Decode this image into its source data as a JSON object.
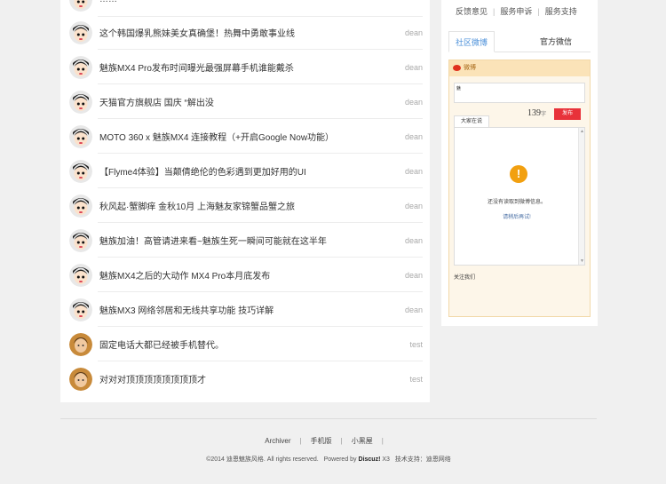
{
  "thread_list": [
    {
      "title": "……",
      "author": "",
      "avatar": "cartoon"
    },
    {
      "title": "这个韩国爆乳熊妹美女真确堡！热舞中勇敢事业线",
      "author": "dean",
      "avatar": "cartoon"
    },
    {
      "title": "魅族MX4 Pro发布时间曝光最强屏幕手机谁能戴杀",
      "author": "dean",
      "avatar": "cartoon"
    },
    {
      "title": "天猫官方旗舰店 国庆 “解出没",
      "author": "dean",
      "avatar": "cartoon"
    },
    {
      "title": "MOTO 360 x 魅族MX4 连接教程（+开启Google Now功能）",
      "author": "dean",
      "avatar": "cartoon"
    },
    {
      "title": "【Flyme4体验】当颠倩绝伦的色彩遇到更加好用的UI",
      "author": "dean",
      "avatar": "cartoon"
    },
    {
      "title": "秋风起·蟹脚痒 金秋10月 上海魅友家锦蟹品蟹之旅",
      "author": "dean",
      "avatar": "cartoon"
    },
    {
      "title": "魅族加油！高管请进来看~魅族生死一瞬间可能就在这半年",
      "author": "dean",
      "avatar": "cartoon"
    },
    {
      "title": "魅族MX4之后的大动作 MX4 Pro本月底发布",
      "author": "dean",
      "avatar": "cartoon"
    },
    {
      "title": "魅族MX3 网络邻居和无线共享功能 技巧详解",
      "author": "dean",
      "avatar": "cartoon"
    },
    {
      "title": "固定电话大都已经被手机替代。",
      "author": "test",
      "avatar": "photo"
    },
    {
      "title": "对对对顶顶顶顶顶顶顶顶才",
      "author": "test",
      "avatar": "photo"
    }
  ],
  "sidebar": {
    "top_links": [
      "反馈意见",
      "服务申诉",
      "服务支持"
    ],
    "tabs": [
      "社区微博",
      "官方微信"
    ],
    "weibo": {
      "header": "微博",
      "compose_text": "魅",
      "char_count": "139",
      "char_unit": "字",
      "send_label": "发布",
      "feed_tab": "大家在说",
      "empty_message": "还没有读取到微博信息。",
      "retry_label": "请稍后再试!",
      "follow_label": "关注我们"
    }
  },
  "footer": {
    "links": [
      "Archiver",
      "手机版",
      "小黑屋"
    ],
    "copyright_prefix": "©2014 迪恩魅族风格. All rights reserved.",
    "powered_label": "Powered by",
    "powered_brand": "Discuz!",
    "powered_version": "X3",
    "support": "技术支持：迪恩网络"
  },
  "colors": {
    "accent_blue": "#4a8fd9",
    "send_red": "#e8323a",
    "warn_orange": "#f2a010",
    "weibo_bg": "#fdf6e9"
  }
}
